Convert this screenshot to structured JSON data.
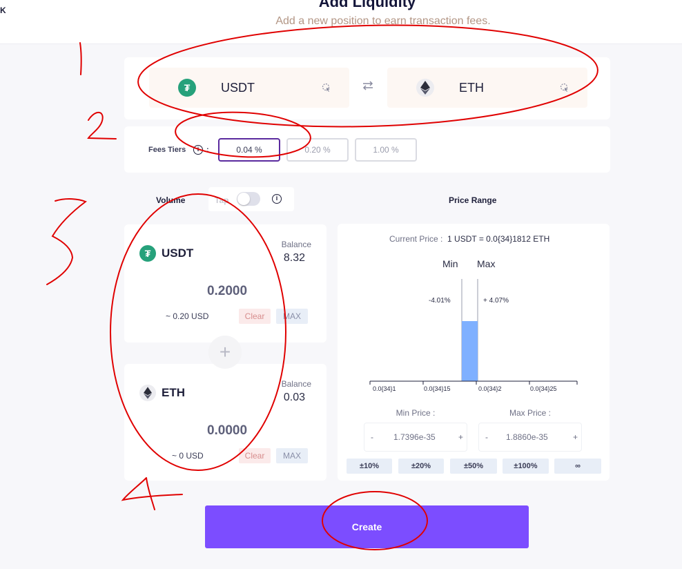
{
  "header": {
    "corner_text": "K",
    "title": "Add Liquidity",
    "subtitle": "Add a new position to earn transaction fees."
  },
  "pair": {
    "token_a": {
      "symbol": "USDT",
      "icon": "tether-icon"
    },
    "token_b": {
      "symbol": "ETH",
      "icon": "ethereum-icon"
    },
    "swap_icon": "swap-arrows-icon"
  },
  "fees": {
    "label": "Fees Tiers",
    "colon": ":",
    "info_glyph": "i",
    "tiers": [
      "0.04 %",
      "0.20 %",
      "1.00 %"
    ],
    "selected": "0.04 %"
  },
  "volume": {
    "heading": "Volume",
    "tap_label": "Tap",
    "toggle_on": false,
    "info_glyph": "i"
  },
  "deposit": {
    "usdt": {
      "symbol": "USDT",
      "balance_label": "Balance",
      "balance": "8.32",
      "amount": "0.2000",
      "usd": "~ 0.20 USD",
      "clear": "Clear",
      "max": "MAX"
    },
    "eth": {
      "symbol": "ETH",
      "balance_label": "Balance",
      "balance": "0.03",
      "amount": "0.0000",
      "usd": "~ 0 USD",
      "clear": "Clear",
      "max": "MAX"
    },
    "plus_glyph": "+"
  },
  "price_range": {
    "heading": "Price Range",
    "current_label": "Current Price :",
    "current_value": "1 USDT = 0.0{34}1812 ETH",
    "min_label": "Min",
    "max_label": "Max",
    "min_pct": "-4.01%",
    "max_pct": "+ 4.07%",
    "ticks": [
      "0.0{34}1",
      "0.0{34}15",
      "0.0{34}2",
      "0.0{34}25"
    ],
    "min_price_label": "Min Price :",
    "max_price_label": "Max Price :",
    "min_price": "1.7396e-35",
    "max_price": "1.8860e-35",
    "minus": "-",
    "plus": "+",
    "quick": [
      "±10%",
      "±20%",
      "±50%",
      "±100%",
      "∞"
    ],
    "bar_color": "#7fb0ff"
  },
  "create_label": "Create",
  "annotations": {
    "marks": [
      "1",
      "2",
      "3",
      "4"
    ],
    "color": "#e00000"
  }
}
